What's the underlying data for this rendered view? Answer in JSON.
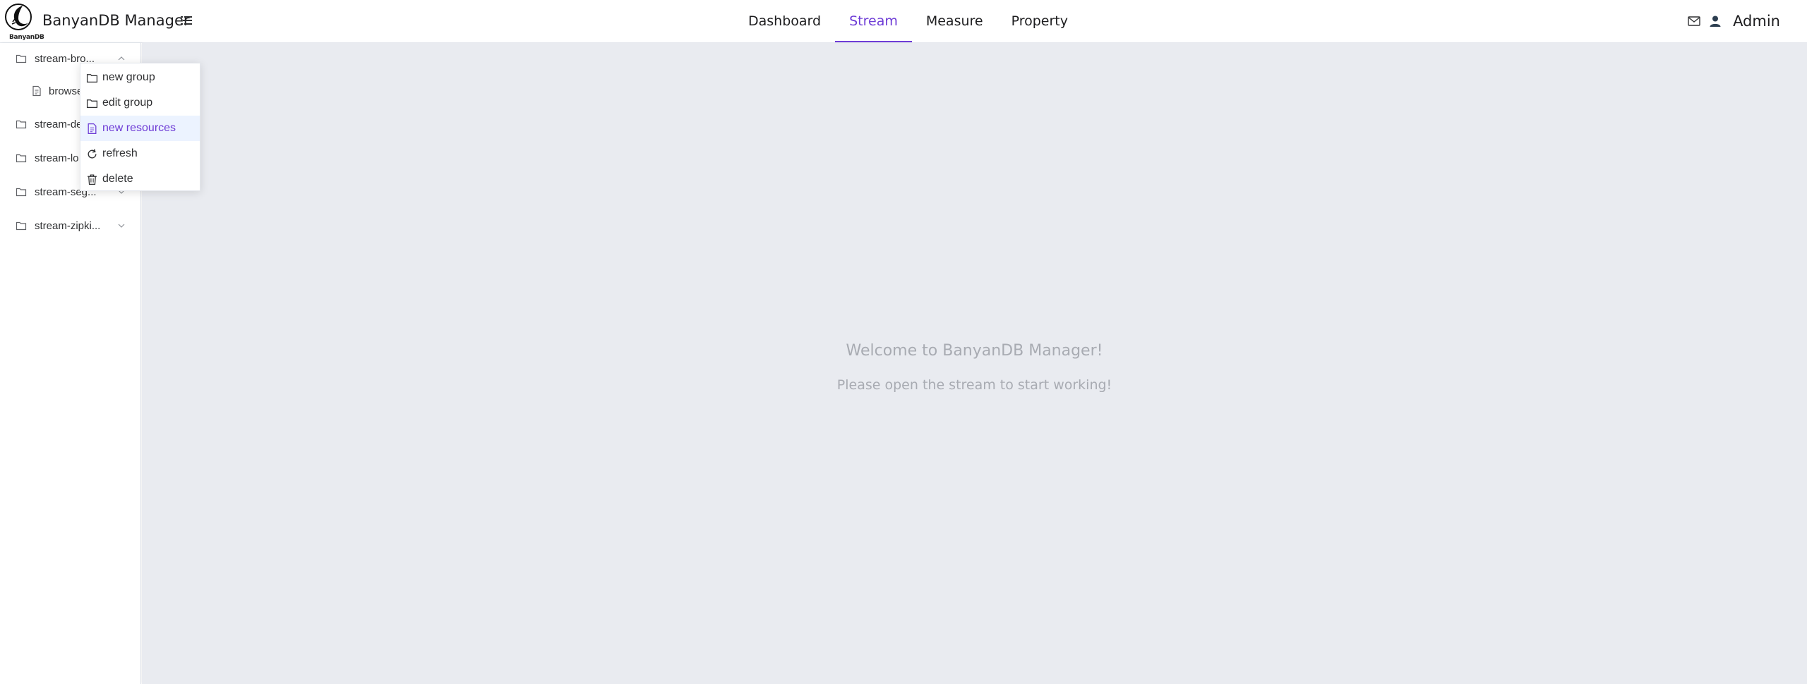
{
  "header": {
    "logo_text": "BanyanDB",
    "title": "BanyanDB Manager",
    "nav": [
      {
        "label": "Dashboard",
        "active": false
      },
      {
        "label": "Stream",
        "active": true
      },
      {
        "label": "Measure",
        "active": false
      },
      {
        "label": "Property",
        "active": false
      }
    ],
    "user": "Admin",
    "icons": [
      "menu-icon",
      "mail-icon",
      "user-icon"
    ]
  },
  "sidebar": {
    "items": [
      {
        "label": "stream-bro...",
        "type": "group",
        "expanded": true
      },
      {
        "label": "browse",
        "type": "resource"
      },
      {
        "label": "stream-de",
        "type": "group"
      },
      {
        "label": "stream-lo",
        "type": "group"
      },
      {
        "label": "stream-seg...",
        "type": "group"
      },
      {
        "label": "stream-zipki...",
        "type": "group"
      }
    ]
  },
  "context_menu": {
    "items": [
      {
        "label": "new group",
        "icon": "folder-icon"
      },
      {
        "label": "edit group",
        "icon": "folder-icon"
      },
      {
        "label": "new resources",
        "icon": "document-icon",
        "highlighted": true
      },
      {
        "label": "refresh",
        "icon": "refresh-icon"
      },
      {
        "label": "delete",
        "icon": "trash-icon"
      }
    ]
  },
  "main": {
    "welcome_title": "Welcome to BanyanDB Manager!",
    "welcome_subtitle": "Please open the stream to start working!"
  },
  "colors": {
    "accent": "#6e3cd6",
    "main_bg": "#e9ebf0",
    "muted_text": "#a8abb2",
    "hover_bg": "#ecf3ff"
  }
}
